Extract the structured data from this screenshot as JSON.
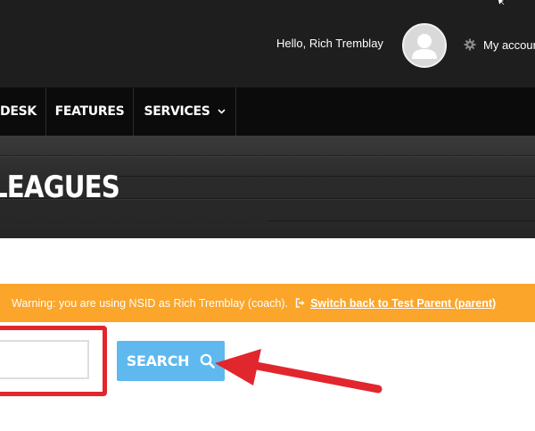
{
  "header": {
    "greeting": "Hello, Rich Tremblay",
    "account_link": "My account"
  },
  "nav": {
    "items": [
      {
        "label": "DESK"
      },
      {
        "label": "FEATURES"
      },
      {
        "label": "SERVICES"
      }
    ]
  },
  "hero": {
    "title": "LEAGUES"
  },
  "warning": {
    "message": "Warning: you are using NSID as Rich Tremblay (coach).",
    "switch_link": "Switch back to Test Parent (parent)"
  },
  "search": {
    "input_value": "",
    "button_label": "SEARCH"
  },
  "colors": {
    "topbar": "#1e1e1e",
    "navbar": "#0b0b0b",
    "warning": "#fba52a",
    "search_button": "#5fb9ee",
    "annotation_red": "#e2262d"
  },
  "icons": [
    "cursor-icon",
    "avatar-icon",
    "gear-icon",
    "chevron-down-icon",
    "sign-out-icon",
    "search-icon",
    "arrow-annotation"
  ]
}
